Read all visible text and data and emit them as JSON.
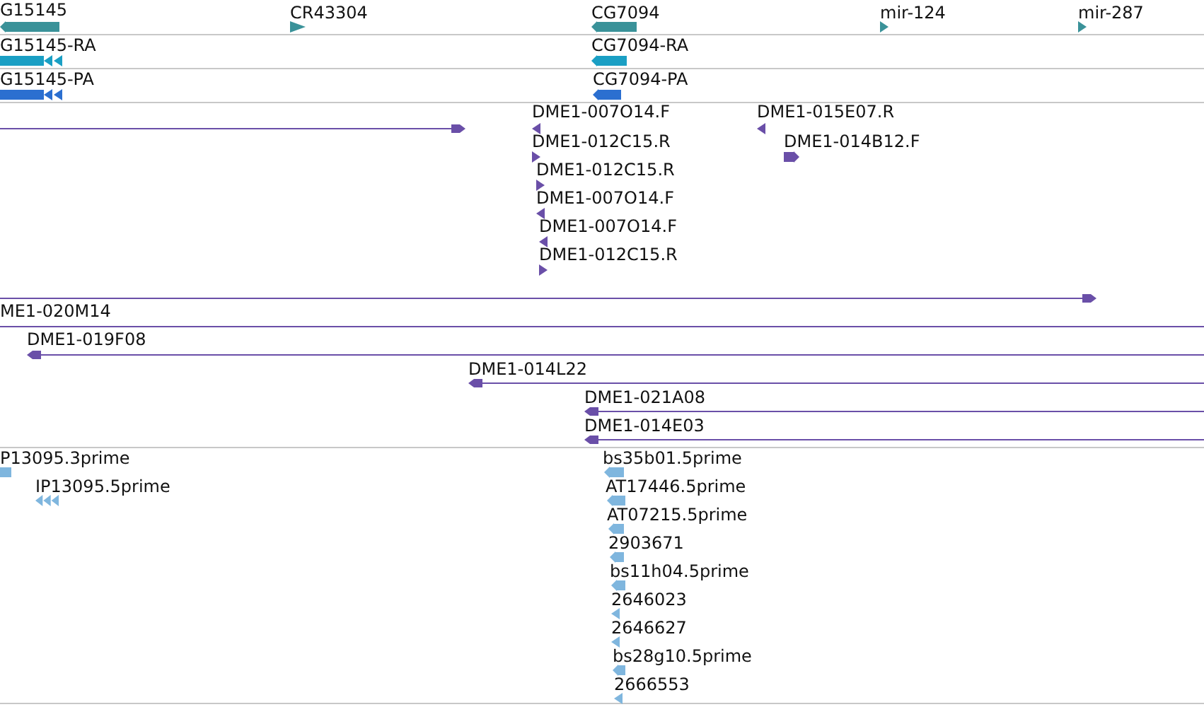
{
  "tracks": [
    {
      "features": [
        {
          "label": "G15145",
          "kind": "block",
          "reverse": true,
          "color": "#3a9299"
        },
        {
          "label": "CR43304",
          "kind": "arrow",
          "reverse": false,
          "color": "#3a9299"
        },
        {
          "label": "CG7094",
          "kind": "block",
          "reverse": true,
          "color": "#3a9299"
        },
        {
          "label": "mir-124",
          "kind": "arrow",
          "reverse": false,
          "color": "#3a9299"
        },
        {
          "label": "mir-287",
          "kind": "arrow",
          "reverse": false,
          "color": "#3a9299"
        },
        {
          "label": "G15145-RA",
          "kind": "chevron_block",
          "reverse": true,
          "color": "#1a9fc4"
        },
        {
          "label": "CG7094-RA",
          "kind": "block",
          "reverse": true,
          "color": "#1a9fc4"
        },
        {
          "label": "G15145-PA",
          "kind": "chevron_block",
          "reverse": true,
          "color": "#2b6fd0"
        },
        {
          "label": "CG7094-PA",
          "kind": "block",
          "reverse": true,
          "color": "#2b6fd0"
        }
      ]
    },
    {
      "color": "#6a4fa8",
      "features": [
        {
          "kind": "line",
          "reverse": false
        },
        {
          "label": "DME1-007O14.F",
          "kind": "arrow",
          "reverse": true
        },
        {
          "label": "DME1-012C15.R",
          "kind": "arrow",
          "reverse": false
        },
        {
          "label": "DME1-012C15.R",
          "kind": "arrow",
          "reverse": false
        },
        {
          "label": "DME1-007O14.F",
          "kind": "arrow",
          "reverse": true
        },
        {
          "label": "DME1-007O14.F",
          "kind": "arrow",
          "reverse": true
        },
        {
          "label": "DME1-012C15.R",
          "kind": "arrow",
          "reverse": false
        },
        {
          "label": "DME1-015E07.R",
          "kind": "arrow",
          "reverse": true
        },
        {
          "label": "DME1-014B12.F",
          "kind": "block",
          "reverse": false
        },
        {
          "kind": "line",
          "reverse": false
        },
        {
          "label": "ME1-020M14",
          "kind": "plain_line"
        },
        {
          "label": "DME1-019F08",
          "kind": "line",
          "reverse": true
        },
        {
          "label": "DME1-014L22",
          "kind": "line",
          "reverse": true
        },
        {
          "label": "DME1-021A08",
          "kind": "line",
          "reverse": true
        },
        {
          "label": "DME1-014E03",
          "kind": "line",
          "reverse": true
        }
      ]
    },
    {
      "color": "#7fb6de",
      "features": [
        {
          "label": "P13095.3prime",
          "kind": "plain_block"
        },
        {
          "label": "IP13095.5prime",
          "kind": "chevrons",
          "reverse": true
        },
        {
          "label": "bs35b01.5prime",
          "kind": "block",
          "reverse": true
        },
        {
          "label": "AT17446.5prime",
          "kind": "block",
          "reverse": true
        },
        {
          "label": "AT07215.5prime",
          "kind": "block",
          "reverse": true
        },
        {
          "label": "2903671",
          "kind": "block",
          "reverse": true
        },
        {
          "label": "bs11h04.5prime",
          "kind": "block",
          "reverse": true
        },
        {
          "label": "2646023",
          "kind": "arrow",
          "reverse": true
        },
        {
          "label": "2646627",
          "kind": "arrow",
          "reverse": true
        },
        {
          "label": "bs28g10.5prime",
          "kind": "block",
          "reverse": true
        },
        {
          "label": "2666553",
          "kind": "arrow",
          "reverse": true
        }
      ]
    }
  ]
}
